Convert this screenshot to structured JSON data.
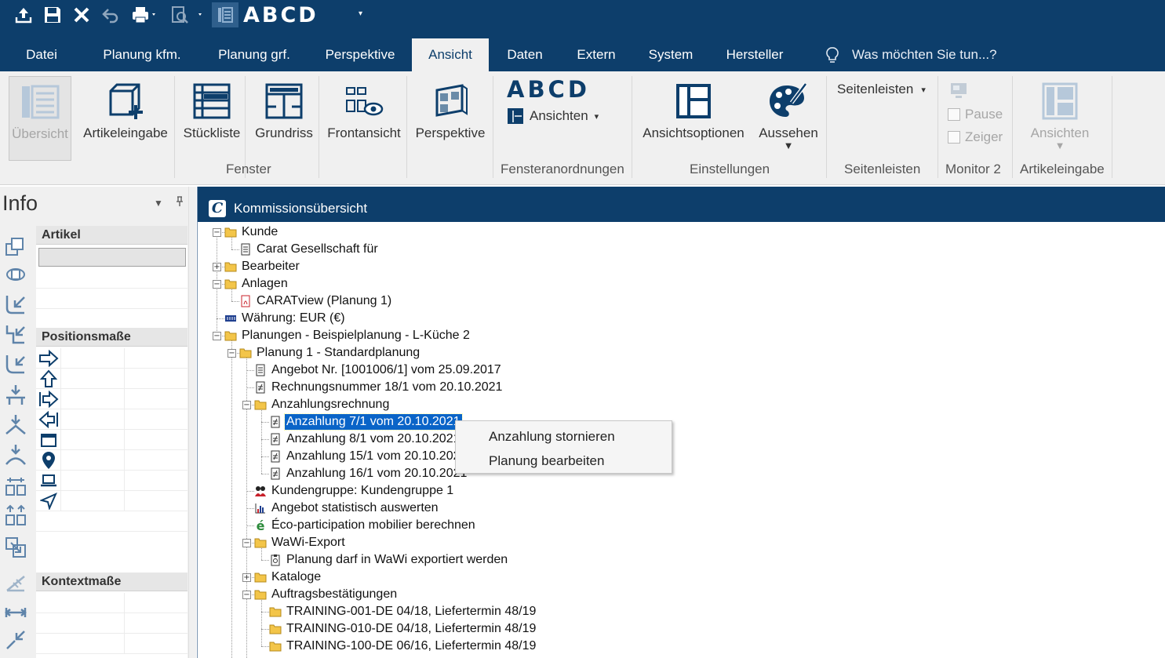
{
  "qat": {
    "brand": "ABCD",
    "icons": [
      "upload-icon",
      "save-icon",
      "close-icon",
      "undo-icon",
      "print-icon",
      "print-preview-icon",
      "catalog-icon"
    ]
  },
  "tabs": [
    {
      "label": "Datei"
    },
    {
      "label": "Planung kfm."
    },
    {
      "label": "Planung grf."
    },
    {
      "label": "Perspektive"
    },
    {
      "label": "Ansicht",
      "active": true
    },
    {
      "label": "Daten"
    },
    {
      "label": "Extern"
    },
    {
      "label": "System"
    },
    {
      "label": "Hersteller"
    }
  ],
  "tellme": "Was möchten Sie tun...?",
  "ribbon": {
    "fenster": {
      "label": "Fenster",
      "buttons": [
        "Übersicht",
        "Artikeleingabe",
        "Stückliste",
        "Grundriss",
        "Frontansicht",
        "Perspektive"
      ]
    },
    "fensteranordnungen": {
      "label": "Fensteranordnungen",
      "brand": "ABCD",
      "ansichten": "Ansichten"
    },
    "einstellungen": {
      "label": "Einstellungen",
      "ansichtsoptionen": "Ansichtsoptionen",
      "aussehen": "Aussehen"
    },
    "seitenleisten": {
      "label": "Seitenleisten",
      "dropdown": "Seitenleisten"
    },
    "monitor2": {
      "label": "Monitor 2",
      "pause": "Pause",
      "zeiger": "Zeiger"
    },
    "artikeleingabe": {
      "label": "Artikeleingabe",
      "ansichten": "Ansichten"
    }
  },
  "info": {
    "title": "Info",
    "sections": {
      "artikel": "Artikel",
      "positionsmasse": "Positionsmaße",
      "kontextmasse": "Kontextmaße"
    }
  },
  "doc": {
    "title": "Kommissionsübersicht",
    "tree": {
      "kunde": "Kunde",
      "kunde_name": "Carat Gesellschaft für",
      "bearbeiter": "Bearbeiter",
      "anlagen": "Anlagen",
      "caratview": "CARATview (Planung 1)",
      "waehrung": "Währung: EUR (€)",
      "planungen": "Planungen - Beispielplanung - L-Küche 2",
      "planung1": "Planung  1 - Standardplanung",
      "angebot": "Angebot Nr. [1001006/1] vom 25.09.2017",
      "rechnung": "Rechnungsnummer 18/1 vom 20.10.2021",
      "anzahlungsrechnung": "Anzahlungsrechnung",
      "anz7": "Anzahlung 7/1 vom 20.10.2021",
      "anz8": "Anzahlung 8/1 vom 20.10.2021",
      "anz15": "Anzahlung 15/1 vom 20.10.2021",
      "anz16": "Anzahlung 16/1 vom 20.10.2021",
      "kundengruppe": "Kundengruppe: Kundengruppe 1",
      "statistik": "Angebot statistisch auswerten",
      "eco": "Éco-participation mobilier berechnen",
      "wawi": "WaWi-Export",
      "wawi_item": "Planung darf in WaWi exportiert werden",
      "kataloge": "Kataloge",
      "auftrag": "Auftragsbestätigungen",
      "t001": "TRAINING-001-DE 04/18, Liefertermin 48/19",
      "t010": "TRAINING-010-DE 04/18, Liefertermin 48/19",
      "t100": "TRAINING-100-DE 06/16, Liefertermin 48/19"
    }
  },
  "context_menu": [
    "Anzahlung stornieren",
    "Planung bearbeiten"
  ],
  "colors": {
    "brand_blue": "#0d3e6b",
    "selection": "#0a64c8",
    "ribbon_bg": "#f0f0f0"
  }
}
